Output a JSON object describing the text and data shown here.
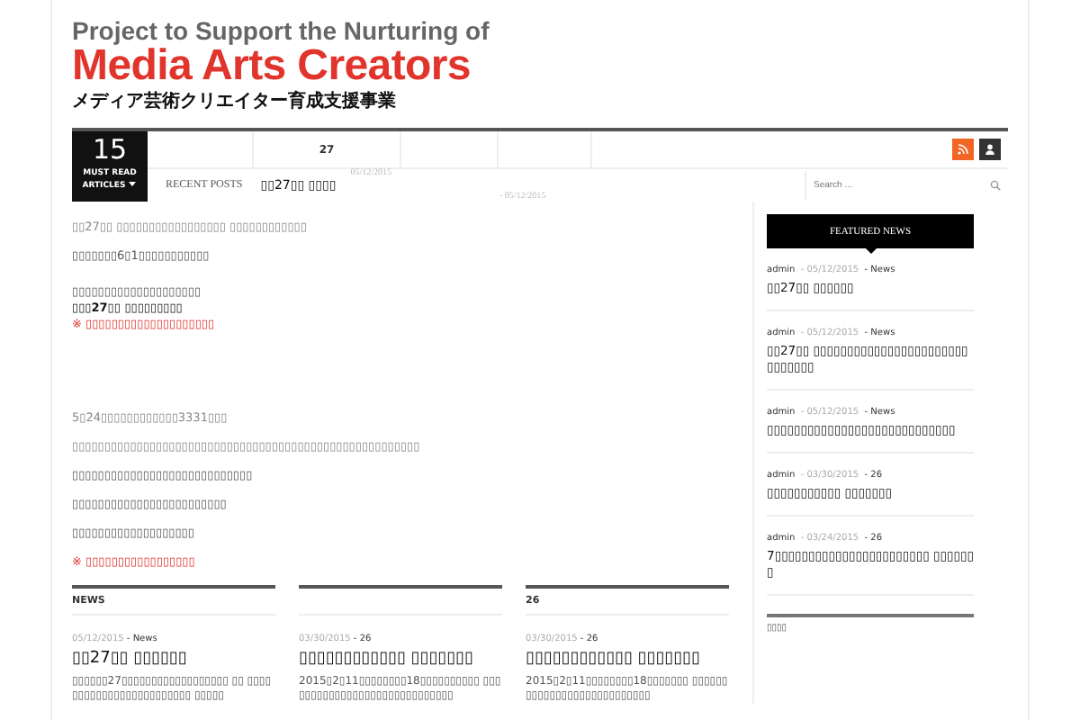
{
  "header": {
    "subtitle": "Project to Support the Nurturing of",
    "title": "Media Arts Creators",
    "tagline": "メディア芸術クリエイター育成支援事業"
  },
  "nav": {
    "count": "15",
    "count_label": "MUST READ",
    "count_label2": "ARTICLES",
    "menu_items": [
      {
        "kind": "empty"
      },
      {
        "kind": "link",
        "label": "27"
      },
      {
        "kind": "empty"
      },
      {
        "kind": "empty"
      }
    ],
    "recent_label": "RECENT POSTS",
    "recent_title": "▯▯27▯▯ ▯▯▯▯",
    "recent_dates": [
      "05/12/2015",
      "- 05/12/2015"
    ],
    "search": {
      "placeholder": "Search ..."
    }
  },
  "article": [
    {
      "kind": "gray",
      "text": "▯▯27▯▯ ▯▯▯▯▯▯▯▯▯▯▯▯▯▯▯▯▯ ▯▯▯▯▯▯▯▯▯▯▯▯"
    },
    {
      "kind": "normal",
      "text": "▯▯▯▯▯▯▯6▯1▯▯▯▯▯▯▯▯▯▯▯"
    },
    {
      "kind": "gap"
    },
    {
      "kind": "tight",
      "text": "▯▯▯▯▯▯▯▯▯▯▯▯▯▯▯▯▯▯▯▯"
    },
    {
      "kind": "bold",
      "text": "▯▯▯27▯▯ ▯▯▯▯▯▯▯▯▯"
    },
    {
      "kind": "red",
      "text": "※ ▯▯▯▯▯▯▯▯▯▯▯▯▯▯▯▯▯▯▯▯"
    },
    {
      "kind": "biggap"
    },
    {
      "kind": "gray",
      "text": "5▯24▯▯▯▯▯▯▯▯▯▯▯▯3331▯▯▯"
    },
    {
      "kind": "gray",
      "text": "▯▯▯▯▯▯▯▯▯▯▯▯▯▯▯▯▯▯▯▯▯▯▯▯▯▯▯▯▯▯▯▯▯▯▯▯▯▯▯▯▯▯▯▯▯▯▯▯▯▯▯▯▯▯"
    },
    {
      "kind": "normal",
      "text": "▯▯▯▯▯▯▯▯▯▯▯▯▯▯▯▯▯▯▯▯▯▯▯▯▯▯▯▯"
    },
    {
      "kind": "normal",
      "text": "▯▯▯▯▯▯▯▯▯▯▯▯▯▯▯▯▯▯▯▯▯▯▯▯"
    },
    {
      "kind": "normal",
      "text": "▯▯▯▯▯▯▯▯▯▯▯▯▯▯▯▯▯▯▯"
    },
    {
      "kind": "red",
      "text": "※ ▯▯▯▯▯▯▯▯▯▯▯▯▯▯▯▯▯"
    }
  ],
  "cards": [
    {
      "heading": "NEWS",
      "date": "05/12/2015",
      "category": "- News",
      "title": "▯▯27▯▯ ▯▯▯▯▯▯",
      "excerpt": "▯▯▯▯▯▯27▯▯▯▯▯▯▯▯▯▯▯▯▯▯▯▯▯▯ ▯▯ ▯▯▯▯▯▯▯▯▯▯▯▯▯▯▯▯▯▯▯▯▯▯▯▯ ▯▯▯▯▯"
    },
    {
      "date": "03/30/2015",
      "category": "- 26",
      "title": "▯▯▯▯▯▯▯▯▯▯▯▯ ▯▯▯▯▯▯▯",
      "excerpt": "2015▯2▯11▯▯▯▯▯▯▯▯18▯▯▯▯▯▯▯▯▯▯ ▯▯▯▯▯▯▯▯▯▯▯▯▯▯▯▯▯▯▯▯▯▯▯▯▯▯▯▯▯"
    },
    {
      "heading": "26",
      "date": "03/30/2015",
      "category": "- 26",
      "title": "▯▯▯▯▯▯▯▯▯▯▯▯ ▯▯▯▯▯▯▯",
      "excerpt": "2015▯2▯11▯▯▯▯▯▯▯▯18▯▯▯▯▯▯▯ ▯▯▯▯▯▯▯▯▯▯▯▯▯▯▯▯▯▯▯▯▯▯▯▯▯▯▯"
    }
  ],
  "sidebar": {
    "title": "FEATURED NEWS",
    "posts": [
      {
        "author": "admin",
        "date": "- 05/12/2015",
        "category": "- News",
        "title": "▯▯27▯▯ ▯▯▯▯▯▯"
      },
      {
        "author": "admin",
        "date": "- 05/12/2015",
        "category": "- News",
        "title": "▯▯27▯▯ ▯▯▯▯▯▯▯▯▯▯▯▯▯▯▯▯▯▯▯▯▯▯▯▯▯▯▯▯▯▯"
      },
      {
        "author": "admin",
        "date": "- 05/12/2015",
        "category": "- News",
        "title": "▯▯▯▯▯▯▯▯▯▯▯▯▯▯▯▯▯▯▯▯▯▯▯▯▯▯▯▯"
      },
      {
        "author": "admin",
        "date": "- 03/30/2015",
        "category": "- 26",
        "title": "▯▯▯▯▯▯▯▯▯▯▯ ▯▯▯▯▯▯▯"
      },
      {
        "author": "admin",
        "date": "- 03/24/2015",
        "category": "- 26",
        "title": "7▯▯▯▯▯▯▯▯▯▯▯▯▯▯▯▯▯▯▯▯▯▯▯ ▯▯▯▯▯▯▯"
      }
    ],
    "widget_title": "▯▯▯▯"
  }
}
